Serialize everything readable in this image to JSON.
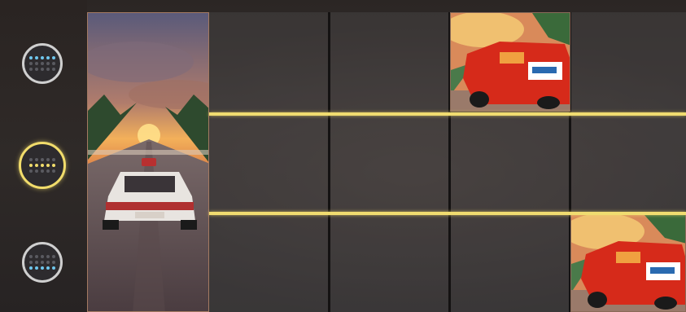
{
  "game": {
    "row_buttons": [
      {
        "name": "row-top",
        "active": false,
        "lit_row": 0
      },
      {
        "name": "row-middle",
        "active": true,
        "lit_row": 1
      },
      {
        "name": "row-bottom",
        "active": false,
        "lit_row": 2
      }
    ],
    "reels": 5,
    "rows": 3,
    "symbols": [
      {
        "reel": 1,
        "rows": [
          0,
          1,
          2
        ],
        "icon": "sunset-highway-car-icon"
      },
      {
        "reel": 3,
        "row": 0,
        "icon": "red-sports-car-icon"
      },
      {
        "reel": 5,
        "row": 2,
        "icon": "red-sports-car-icon"
      }
    ],
    "colors": {
      "payline": "#f0dc70",
      "button_active": "#f1dc6b",
      "button_inactive": "#cfcfcf",
      "dot_lit_blue": "#6fc7ee",
      "dot_lit_yellow": "#f0dc6b"
    }
  }
}
